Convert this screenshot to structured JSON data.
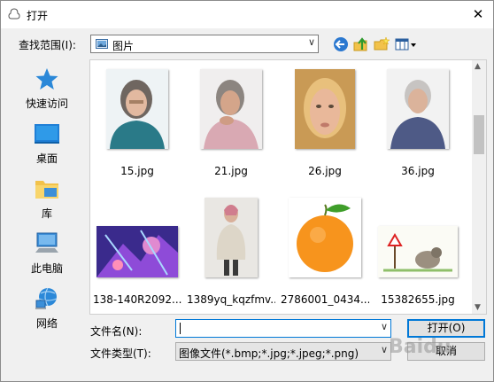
{
  "window": {
    "title": "打开",
    "close_glyph": "✕"
  },
  "toolbar": {
    "lookin_label": "查找范围(I):",
    "lookin_value": "图片",
    "buttons": [
      "back-icon",
      "up-folder-icon",
      "new-folder-icon",
      "view-menu-icon"
    ]
  },
  "places": [
    {
      "label": "快速访问",
      "icon": "star-icon"
    },
    {
      "label": "桌面",
      "icon": "desktop-icon"
    },
    {
      "label": "库",
      "icon": "library-icon"
    },
    {
      "label": "此电脑",
      "icon": "computer-icon"
    },
    {
      "label": "网络",
      "icon": "network-icon"
    }
  ],
  "files": [
    {
      "name": "15.jpg"
    },
    {
      "name": "21.jpg"
    },
    {
      "name": "26.jpg"
    },
    {
      "name": "36.jpg"
    },
    {
      "name": "138-140R2092..."
    },
    {
      "name": "1389yq_kqzfmv..."
    },
    {
      "name": "2786001_0434..."
    },
    {
      "name": "15382655.jpg"
    }
  ],
  "form": {
    "filename_label": "文件名(N):",
    "filename_value": "",
    "filetype_label": "文件类型(T):",
    "filetype_value": "图像文件(*.bmp;*.jpg;*.jpeg;*.png)"
  },
  "buttons": {
    "open": "打开(O)",
    "cancel": "取消"
  },
  "watermark": "Baidu"
}
